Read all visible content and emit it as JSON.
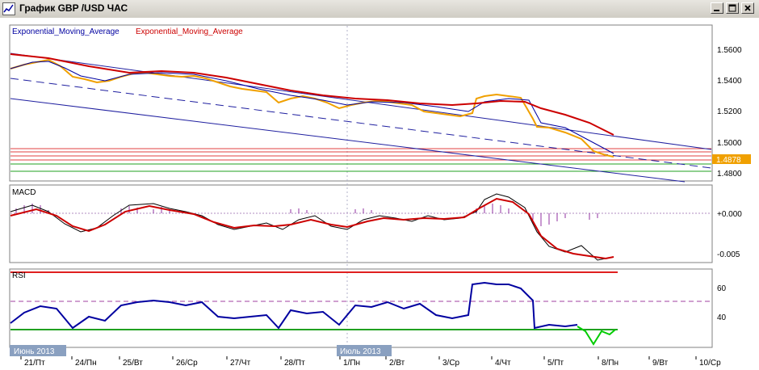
{
  "window": {
    "title": "График GBP /USD  ЧАС",
    "minimize_icon": "minimize-icon",
    "maximize_icon": "maximize-icon",
    "close_icon": "close-icon"
  },
  "colors": {
    "price_bar": "#f0a000",
    "ema_fast": "#0000a0",
    "ema_slow": "#cc0000",
    "channel": "#2020a0",
    "support_red": "#e04040",
    "support_green": "#20a020",
    "rsi_line": "#0000a0",
    "rsi_green": "#00cc00",
    "grid": "#9090b0"
  },
  "price_panel": {
    "legend_1": "Exponential_Moving_Average",
    "legend_2": "Exponential_Moving_Average",
    "current_price": "1.4878",
    "axis_labels": [
      "1.5600",
      "1.5400",
      "1.5200",
      "1.5000",
      "1.4800"
    ]
  },
  "macd_panel": {
    "label": "MACD",
    "axis_labels": [
      "+0.000",
      "-0.005"
    ]
  },
  "rsi_panel": {
    "label": "RSI",
    "axis_labels": [
      "60",
      "40"
    ]
  },
  "time_axis": {
    "month_marker_1": "Июнь 2013",
    "month_marker_2": "Июль 2013",
    "labels": [
      "21/Пт",
      "24/Пн",
      "25/Вт",
      "26/Ср",
      "27/Чт",
      "28/Пт",
      "1/Пн",
      "2/Вт",
      "3/Ср",
      "4/Чт",
      "5/Пт",
      "8/Пн",
      "9/Вт",
      "10/Ср"
    ]
  }
}
